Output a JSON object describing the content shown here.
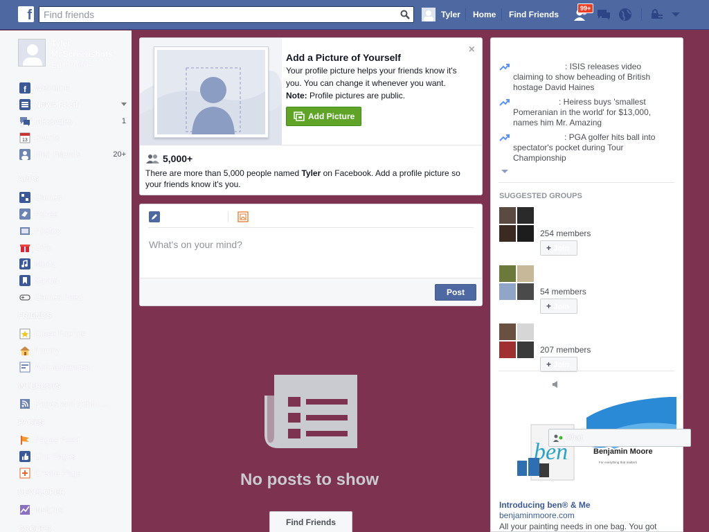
{
  "topbar": {
    "logo_letter": "f",
    "search_placeholder": "Find friends",
    "user_name": "Tyler",
    "home": "Home",
    "find_friends": "Find Friends",
    "friend_requests_badge": "99+"
  },
  "sidebar": {
    "profile": {
      "name": "Tyler McScreenshots",
      "edit": "Edit Profile"
    },
    "favorites": [
      {
        "label": "Welcome",
        "icon": "facebook-icon",
        "count": ""
      },
      {
        "label": "News Feed",
        "icon": "news-feed-icon",
        "count": ""
      },
      {
        "label": "Messages",
        "icon": "messages-icon",
        "count": "1"
      },
      {
        "label": "Events",
        "icon": "calendar-icon",
        "count": ""
      },
      {
        "label": "Find Friends",
        "icon": "find-friends-icon",
        "count": "20+"
      }
    ],
    "apps_head": "APPS",
    "apps": [
      {
        "label": "Games",
        "icon": "games-icon"
      },
      {
        "label": "Pokes",
        "icon": "pokes-icon"
      },
      {
        "label": "Photos",
        "icon": "photos-icon"
      },
      {
        "label": "Gifts",
        "icon": "gifts-icon"
      },
      {
        "label": "Music",
        "icon": "music-icon"
      },
      {
        "label": "Saved",
        "icon": "saved-icon"
      },
      {
        "label": "Games Feed",
        "icon": "controller-icon"
      }
    ],
    "friends_head": "FRIENDS",
    "friends": [
      {
        "label": "Close Friends",
        "icon": "star-icon"
      },
      {
        "label": "Family",
        "icon": "house-icon"
      },
      {
        "label": "Acquaintances",
        "icon": "acquaintances-icon"
      }
    ],
    "interests_head": "INTERESTS",
    "interests": [
      {
        "label": "Pages and Public ...",
        "icon": "rss-icon"
      }
    ],
    "pages_head": "PAGES",
    "pages": [
      {
        "label": "Pages Feed",
        "icon": "flag-icon"
      },
      {
        "label": "Like Pages",
        "icon": "like-icon"
      },
      {
        "label": "Create Page",
        "icon": "create-page-icon"
      }
    ],
    "developer_head": "DEVELOPER",
    "developer": [
      {
        "label": "Insights",
        "icon": "insights-icon"
      }
    ],
    "groups_head": "GROUPS"
  },
  "profile_prompt": {
    "title": "Add a Picture of Yourself",
    "desc": "Your profile picture helps your friends know it's you. You can change it whenever you want.",
    "note_label": "Note:",
    "note_text": " Profile pictures are public.",
    "button": "Add Picture",
    "close": "×",
    "count": "5,000+",
    "namesake_pre": "There are more than 5,000 people named ",
    "namesake_name": "Tyler",
    "namesake_post": " on Facebook. Add a profile picture so your friends know it's you."
  },
  "composer": {
    "placeholder": "What's on your mind?",
    "post_button": "Post"
  },
  "feed": {
    "empty_text": "No posts to show",
    "find_friends_button": "Find Friends"
  },
  "trending": [
    {
      "text": ": ISIS releases video claiming to show beheading of British hostage David Haines"
    },
    {
      "text": ": Heiress buys 'smallest Pomeranian in the world' for $13,000, names him Mr. Amazing"
    },
    {
      "text": ": PGA golfer hits ball into spectator's pocket during Tour Championship"
    }
  ],
  "suggested_groups": {
    "heading": "SUGGESTED GROUPS",
    "join_label": "Join",
    "groups": [
      {
        "members": "254 members"
      },
      {
        "members": "54 members"
      },
      {
        "members": "207 members"
      }
    ]
  },
  "ad": {
    "logo_text": "ben",
    "brand_text": "Benjamin Moore",
    "tagline": "For everything that matters",
    "title": "Introducing ben® & Me",
    "url": "benjaminmoore.com",
    "desc": "All your painting needs in one bag. You got"
  },
  "chat": {
    "label": "Chat"
  },
  "colors": {
    "topbar": "#4e69a2",
    "background": "#7d3350",
    "post_button": "#4e69a2",
    "add_picture": "#5fa427"
  }
}
